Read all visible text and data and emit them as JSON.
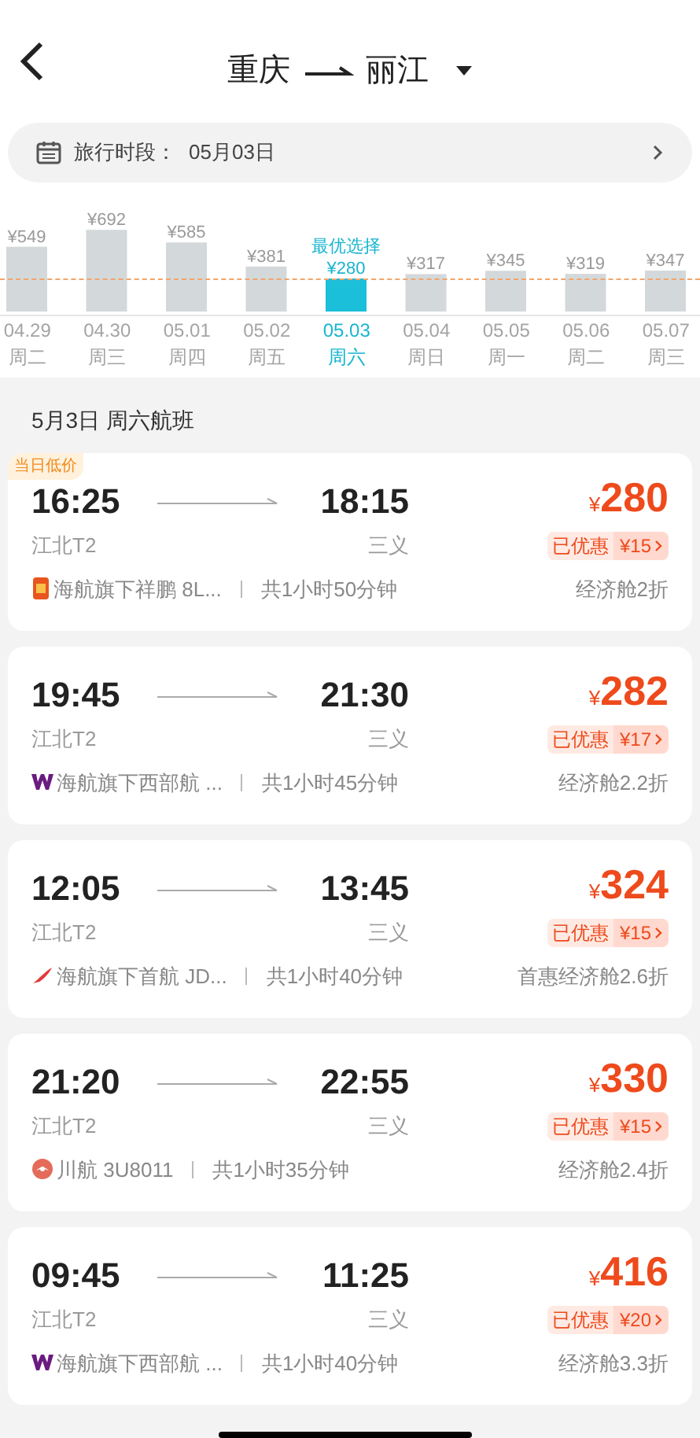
{
  "header": {
    "from": "重庆",
    "to": "丽江"
  },
  "date_bar": {
    "label": "旅行时段：",
    "value": "05月03日"
  },
  "calendar": {
    "best_label": "最优选择",
    "days": [
      {
        "weekday": "周二",
        "selected": false
      },
      {
        "weekday": "周三",
        "selected": false
      },
      {
        "weekday": "周四",
        "selected": false
      },
      {
        "weekday": "周五",
        "selected": false
      },
      {
        "weekday": "周六",
        "selected": true
      },
      {
        "weekday": "周日",
        "selected": false
      },
      {
        "weekday": "周一",
        "selected": false
      },
      {
        "weekday": "周二",
        "selected": false
      },
      {
        "weekday": "周三",
        "selected": false
      }
    ],
    "chart_data": {
      "type": "bar",
      "categories": [
        "04.29",
        "04.30",
        "05.01",
        "05.02",
        "05.03",
        "05.04",
        "05.05",
        "05.06",
        "05.07"
      ],
      "values": [
        549,
        692,
        585,
        381,
        280,
        317,
        345,
        319,
        347
      ],
      "value_labels": [
        "¥549",
        "¥692",
        "¥585",
        "¥381",
        "¥280",
        "¥317",
        "¥345",
        "¥319",
        "¥347"
      ]
    }
  },
  "section_title": "5月3日 周六航班",
  "flights": [
    {
      "badge": "当日低价",
      "depart": "16:25",
      "arrive": "18:15",
      "from_airport": "江北T2",
      "to_airport": "三义",
      "currency": "¥",
      "price": "280",
      "discount_label": "已优惠",
      "discount": "¥15",
      "kind": "square",
      "airline": "海航旗下祥鹏 8L...",
      "duration": "共1小时50分钟",
      "cabin": "经济舱2折"
    },
    {
      "depart": "19:45",
      "arrive": "21:30",
      "from_airport": "江北T2",
      "to_airport": "三义",
      "currency": "¥",
      "price": "282",
      "discount_label": "已优惠",
      "discount": "¥17",
      "kind": "w",
      "airline": "海航旗下西部航 ...",
      "duration": "共1小时45分钟",
      "cabin": "经济舱2.2折"
    },
    {
      "depart": "12:05",
      "arrive": "13:45",
      "from_airport": "江北T2",
      "to_airport": "三义",
      "currency": "¥",
      "price": "324",
      "discount_label": "已优惠",
      "discount": "¥15",
      "kind": "wing",
      "airline": "海航旗下首航 JD...",
      "duration": "共1小时40分钟",
      "cabin": "首惠经济舱2.6折"
    },
    {
      "depart": "21:20",
      "arrive": "22:55",
      "from_airport": "江北T2",
      "to_airport": "三义",
      "currency": "¥",
      "price": "330",
      "discount_label": "已优惠",
      "discount": "¥15",
      "kind": "round",
      "airline": "川航 3U8011",
      "duration": "共1小时35分钟",
      "cabin": "经济舱2.4折"
    },
    {
      "depart": "09:45",
      "arrive": "11:25",
      "from_airport": "江北T2",
      "to_airport": "三义",
      "currency": "¥",
      "price": "416",
      "discount_label": "已优惠",
      "discount": "¥20",
      "kind": "w",
      "airline": "海航旗下西部航 ...",
      "duration": "共1小时40分钟",
      "cabin": "经济舱3.3折"
    }
  ]
}
